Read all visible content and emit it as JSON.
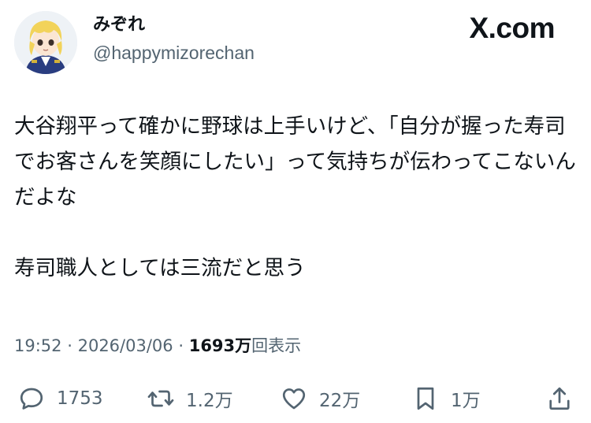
{
  "author": {
    "display_name": "みぞれ",
    "handle": "@happymizorechan"
  },
  "brand": "X.com",
  "tweet": {
    "text": "大谷翔平って確かに野球は上手いけど、「自分が握った寿司でお客さんを笑顔にしたい」って気持ちが伝わってこないんだよな\n\n寿司職人としては三流だと思う"
  },
  "meta": {
    "time": "19:52",
    "separator": "·",
    "date": "2026/03/06",
    "views_value": "1693万",
    "views_label": "回表示"
  },
  "actions": {
    "reply_count": "1753",
    "retweet_count": "1.2万",
    "like_count": "22万",
    "bookmark_count": "1万"
  },
  "icons": {
    "reply": "speech-bubble-icon",
    "retweet": "retweet-arrows-icon",
    "like": "heart-icon",
    "bookmark": "bookmark-icon",
    "share": "share-upload-icon"
  },
  "colors": {
    "text": "#0f1419",
    "secondary": "#536471",
    "avatar_hair": "#f2d35a",
    "avatar_uniform": "#2a3d80"
  }
}
